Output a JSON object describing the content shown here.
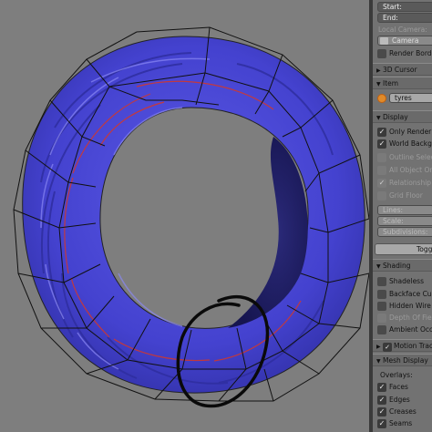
{
  "panel": {
    "camera": {
      "start_label": "Start:",
      "end_label": "End:",
      "local_camera_label": "Local Camera:",
      "camera_field": "Camera"
    },
    "render_border": {
      "label": "Render Border",
      "checked": true
    },
    "sections": {
      "cursor_3d": "3D Cursor",
      "item": "Item",
      "display": "Display",
      "shading": "Shading",
      "motion_tracking": "Motion Track",
      "mesh_display": "Mesh Display"
    },
    "item": {
      "name_value": "tyres"
    },
    "display": {
      "only_render": "Only Render",
      "world_background": "World Backgrou",
      "outline_selected": "Outline Selecte",
      "all_object_origins": "All Object Origi",
      "relationship_lines": "Relationship Lin",
      "grid_floor": "Grid Floor",
      "lines": "Lines:",
      "scale": "Scale:",
      "subdivisions": "Subdivisions:",
      "toggle_button": "Toggl"
    },
    "shading": {
      "shadeless": "Shadeless",
      "backface_culling": "Backface Cullin",
      "hidden_wire": "Hidden Wire",
      "depth_of_field": "Depth Of Field",
      "ambient_occlusion": "Ambient Occlus"
    },
    "mesh_display": {
      "overlays_label": "Overlays:",
      "faces": "Faces",
      "edges": "Edges",
      "creases": "Creases",
      "seams": "Seams"
    }
  },
  "colors": {
    "viewport_bg": "#7e7e7e",
    "tyre_fill": "#4a48d8",
    "tyre_highlight": "#7e7cf0",
    "seam_red": "#d0382e",
    "panel_bg": "#727272"
  }
}
